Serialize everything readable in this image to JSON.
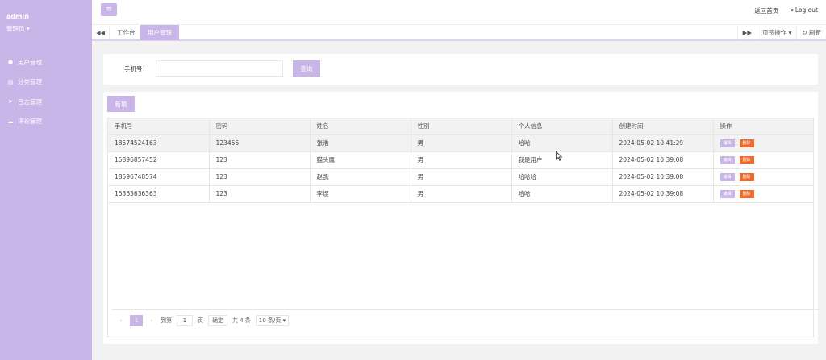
{
  "sidebar": {
    "username": "admin",
    "role": "管理员",
    "items": [
      {
        "icon": "user-icon",
        "glyph": "●",
        "label": "用户管理"
      },
      {
        "icon": "list-icon",
        "glyph": "▤",
        "label": "分类管理"
      },
      {
        "icon": "send-icon",
        "glyph": "➤",
        "label": "日志管理"
      },
      {
        "icon": "comment-icon",
        "glyph": "☁",
        "label": "评论管理"
      }
    ]
  },
  "header": {
    "menu_glyph": "≡",
    "home_link": "返回首页",
    "logout": "Log out",
    "logout_glyph": "⇥"
  },
  "tabs": {
    "prev_glyph": "◀◀",
    "next_glyph": "▶▶",
    "items": [
      {
        "label": "工作台"
      },
      {
        "label": "用户管理"
      }
    ],
    "page_ops": "页签操作",
    "refresh": "刷新"
  },
  "search": {
    "label": "手机号：",
    "value": "",
    "button": "查询"
  },
  "table": {
    "add_button": "新增",
    "columns": [
      "手机号",
      "密码",
      "姓名",
      "性别",
      "个人信息",
      "创建时间",
      "操作"
    ],
    "rows": [
      [
        "18574524163",
        "123456",
        "张浩",
        "男",
        "哈哈",
        "2024-05-02 10:41:29"
      ],
      [
        "15896857452",
        "123",
        "猫头鹰",
        "男",
        "我是用户",
        "2024-05-02 10:39:08"
      ],
      [
        "18596748574",
        "123",
        "赵凯",
        "男",
        "哈哈哈",
        "2024-05-02 10:39:08"
      ],
      [
        "15363636363",
        "123",
        "李煜",
        "男",
        "哈哈",
        "2024-05-02 10:39:08"
      ]
    ],
    "edit_label": "编辑",
    "delete_label": "删除"
  },
  "pager": {
    "prev_glyph": "‹",
    "next_glyph": "›",
    "current_page": "1",
    "goto_label": "到第",
    "page_input": "1",
    "page_unit": "页",
    "confirm": "确定",
    "total": "共 4 条",
    "page_size": "10 条/页"
  },
  "colors": {
    "accent": "#cab5e8",
    "danger": "#ee6a2b"
  }
}
